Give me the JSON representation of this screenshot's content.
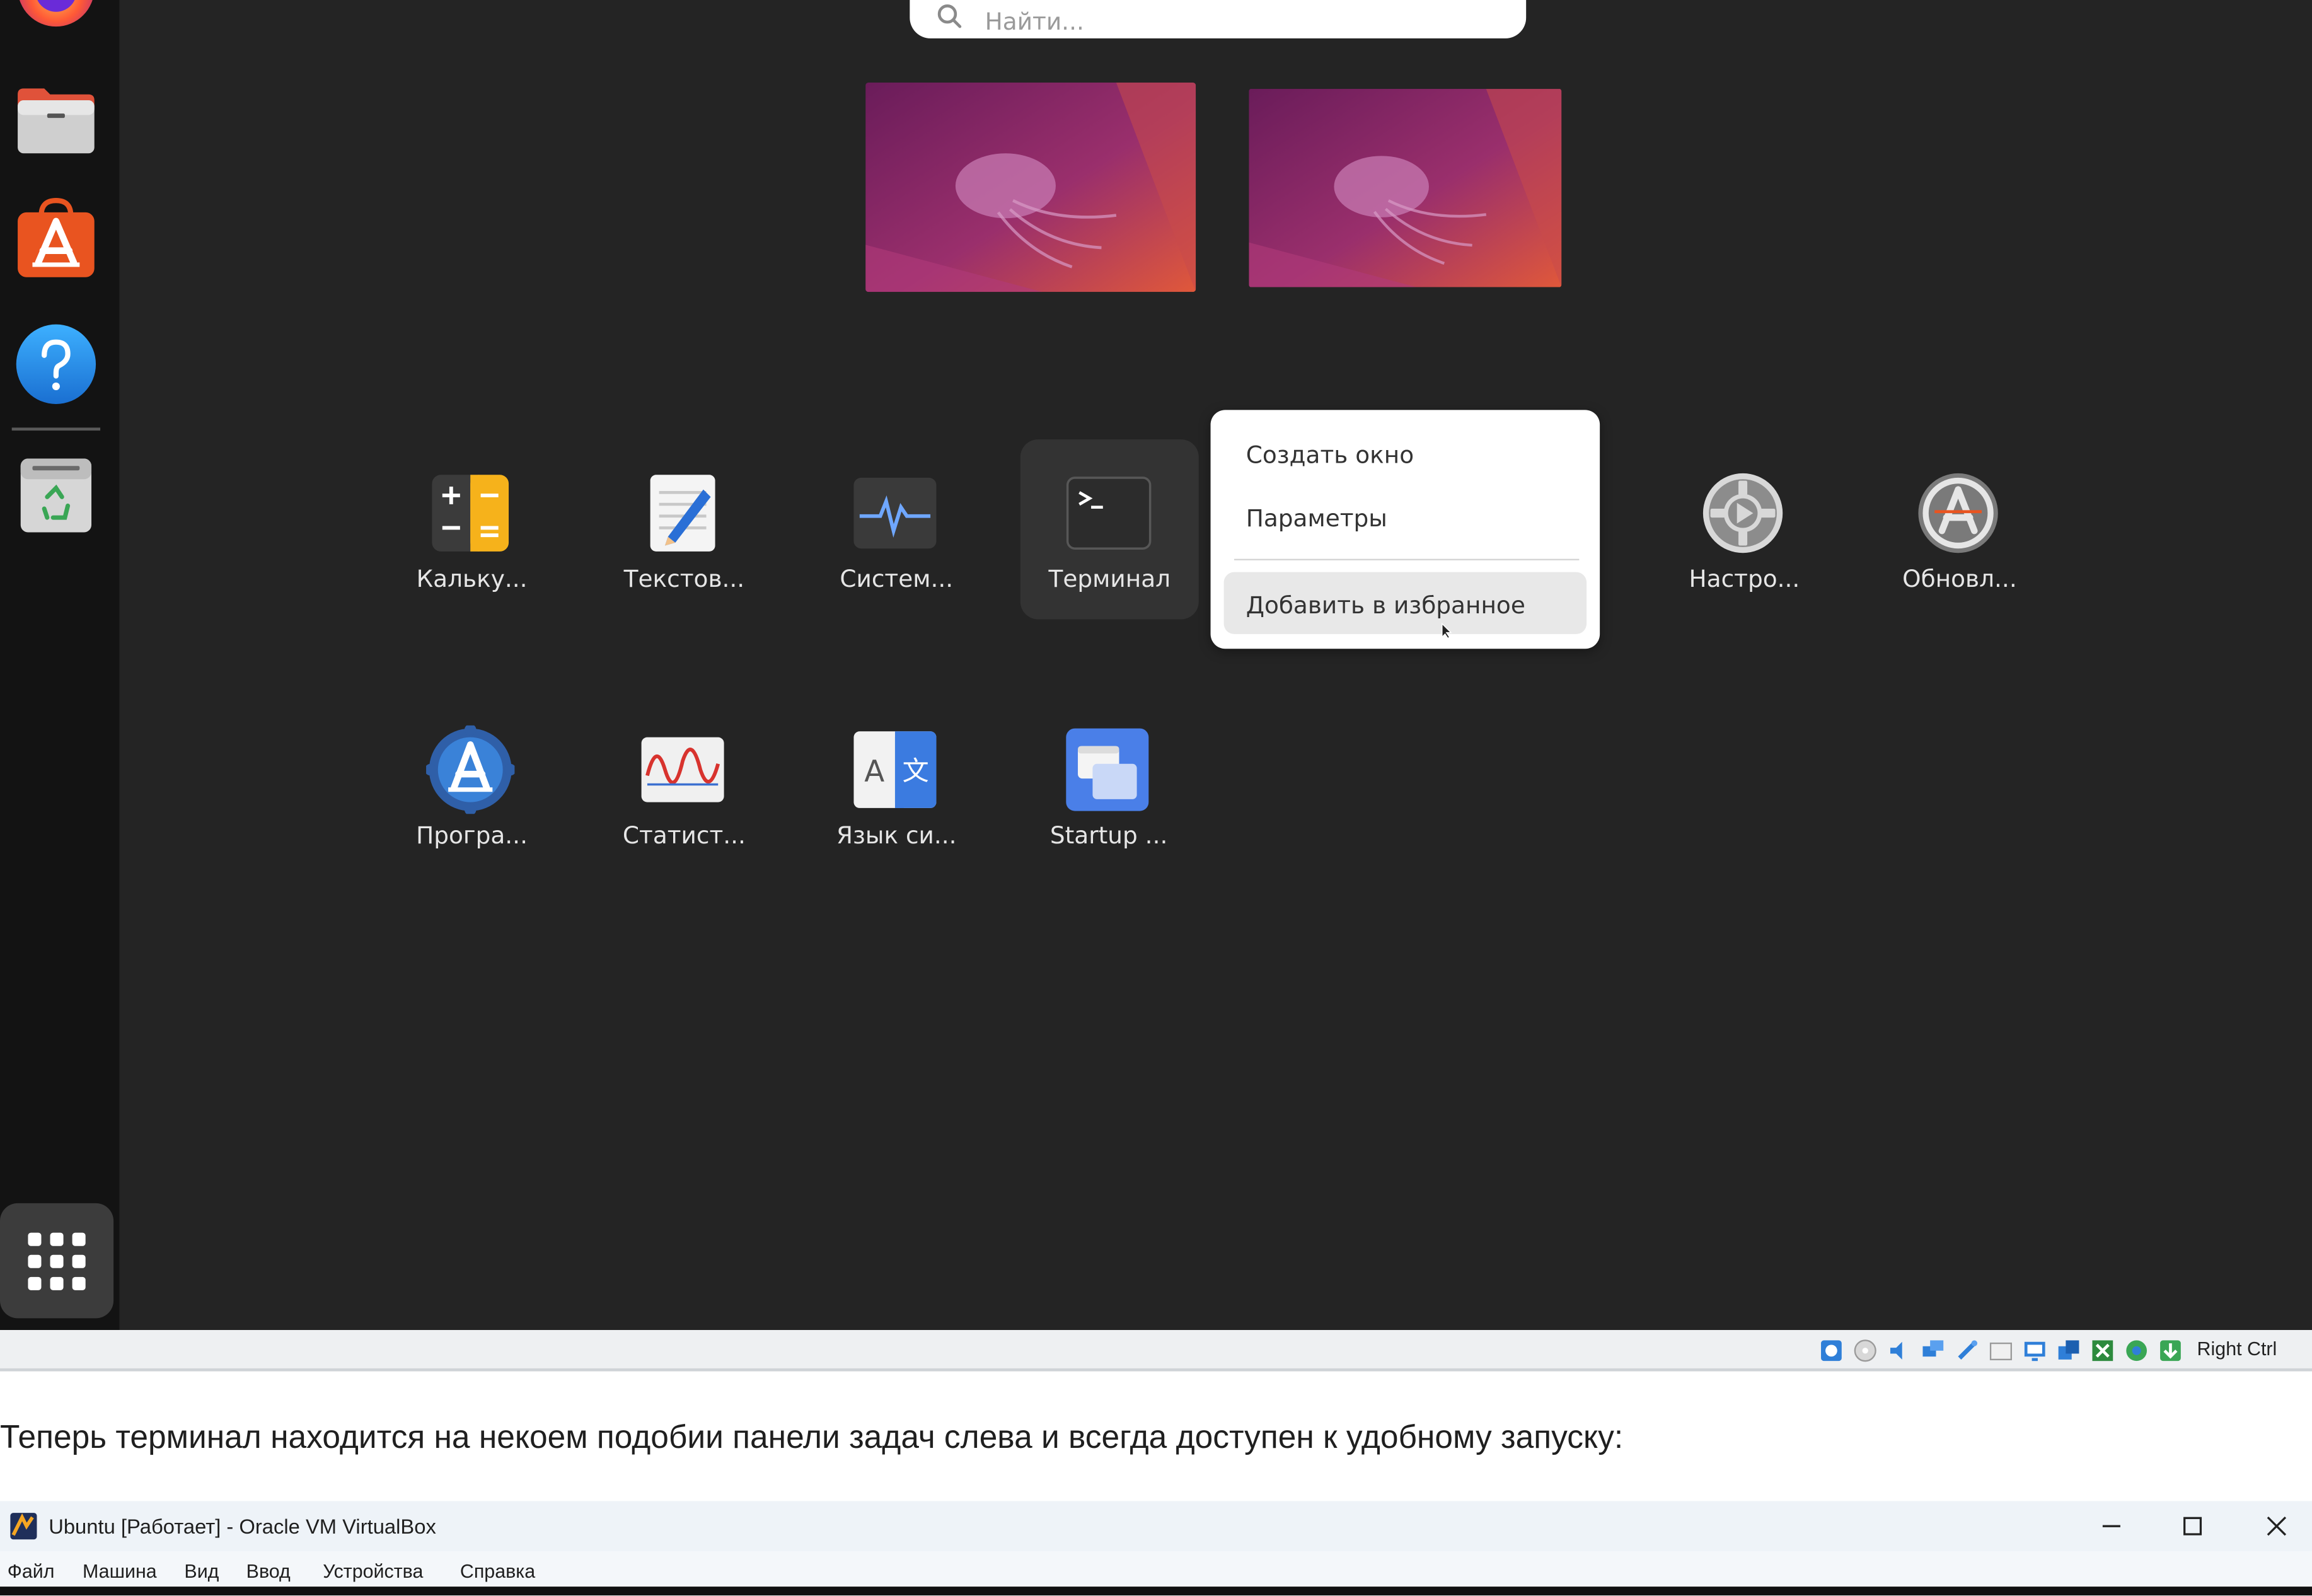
{
  "overview": {
    "search_placeholder": "Найти..."
  },
  "dock": {
    "items": [
      "firefox-icon",
      "files-icon",
      "app-center-icon",
      "help-icon",
      "trash-icon"
    ],
    "show_apps_icon": "grid-icon"
  },
  "apps": [
    {
      "label": "Кальку...",
      "icon": "calculator-icon"
    },
    {
      "label": "Текстов...",
      "icon": "text-editor-icon"
    },
    {
      "label": "Систем...",
      "icon": "system-monitor-icon"
    },
    {
      "label": "Терминал",
      "icon": "terminal-icon"
    },
    {
      "label": "Настро...",
      "icon": "settings-icon"
    },
    {
      "label": "Обновл...",
      "icon": "software-updater-icon"
    },
    {
      "label": "Програ...",
      "icon": "software-properties-icon"
    },
    {
      "label": "Статист...",
      "icon": "power-statistics-icon"
    },
    {
      "label": "Язык си...",
      "icon": "language-support-icon"
    },
    {
      "label": "Startup ...",
      "icon": "startup-disk-icon"
    }
  ],
  "context_menu": {
    "new_window": "Создать окно",
    "details": "Параметры",
    "add_favorite": "Добавить в избранное"
  },
  "statusbar": {
    "host_key": "Right Ctrl"
  },
  "doc": {
    "paragraph": "Теперь терминал находится на некоем подобии панели задач слева и всегда доступен к удобному запуску:"
  },
  "vbox_window": {
    "title": "Ubuntu [Работает] - Oracle VM VirtualBox",
    "menu": [
      "Файл",
      "Машина",
      "Вид",
      "Ввод",
      "Устройства",
      "Справка"
    ]
  },
  "colors": {
    "guest_bg": "#242424",
    "dock_bg": "#131313",
    "ubuntu_orange": "#e95420",
    "wallpaper_purple": "#8a2a6a"
  }
}
